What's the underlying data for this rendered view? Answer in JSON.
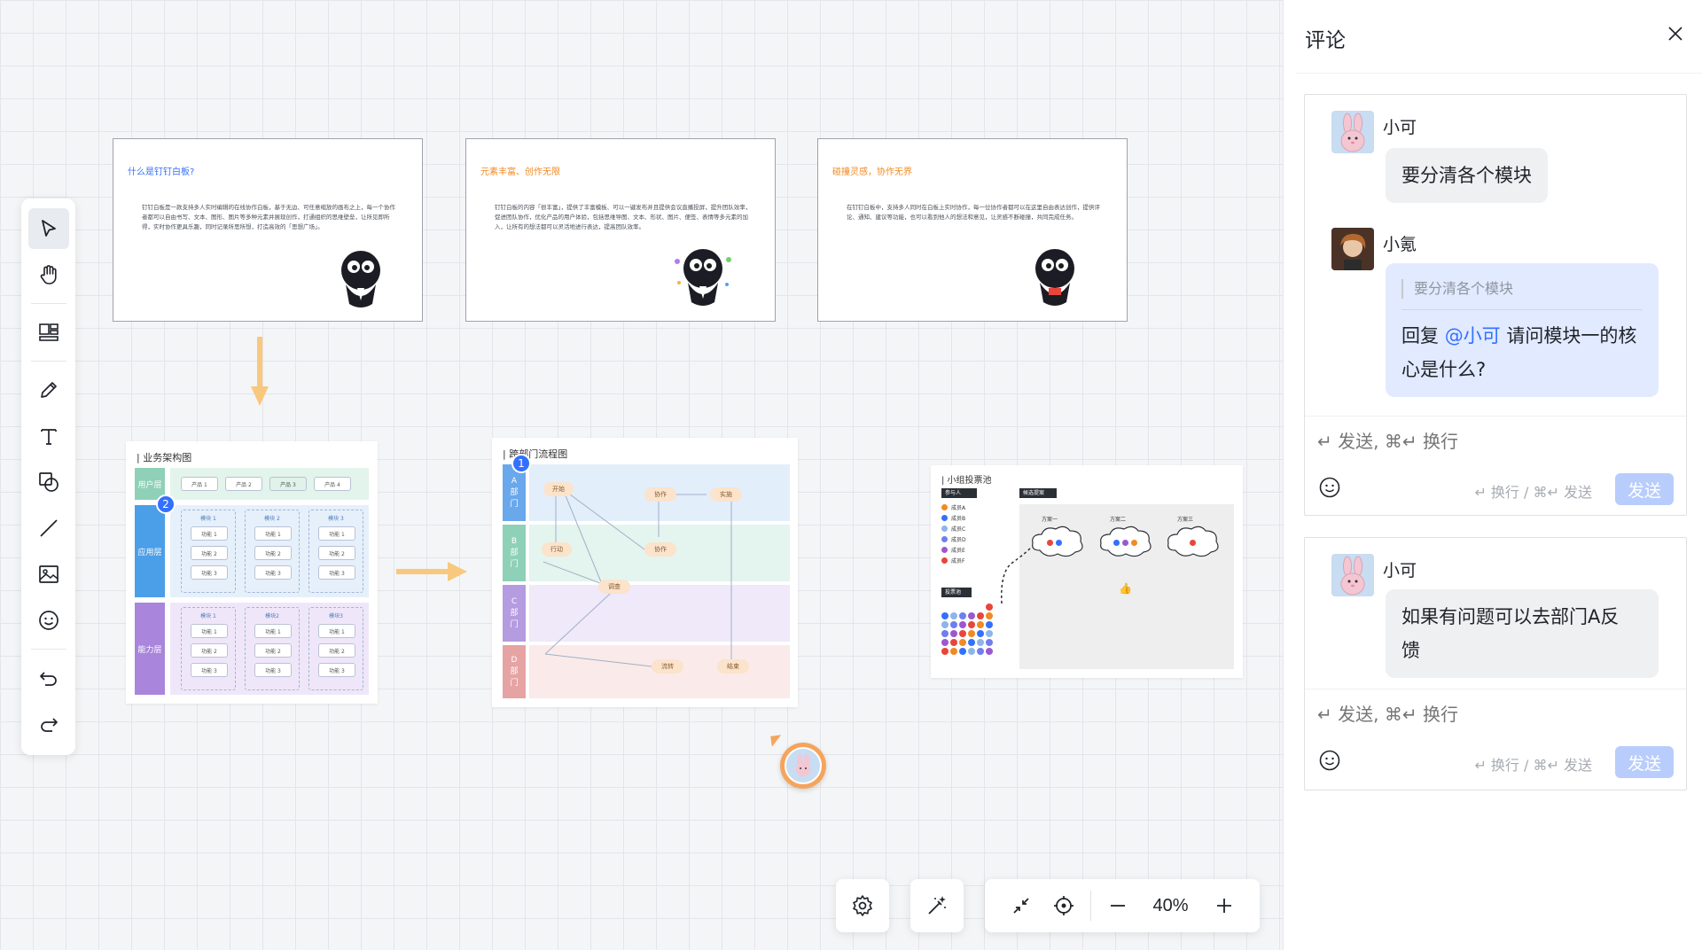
{
  "panel": {
    "title": "评论",
    "threads": [
      {
        "messages": [
          {
            "author": "小可",
            "text": "要分清各个模块"
          },
          {
            "author": "小氪",
            "quote": "要分清各个模块",
            "reply_prefix": "回复 ",
            "mention": "@小可",
            "reply_text_1": " 请问模块一的核",
            "reply_text_2": "心是什么?"
          }
        ],
        "input_placeholder": "↵ 发送, ⌘↵ 换行",
        "hint": "↵ 换行 / ⌘↵ 发送",
        "send_label": "发送"
      },
      {
        "messages": [
          {
            "author": "小可",
            "text_1": "如果有问题可以去部门A反",
            "text_2": "馈"
          }
        ],
        "input_placeholder": "↵ 发送, ⌘↵ 换行",
        "hint": "↵ 换行 / ⌘↵ 发送",
        "send_label": "发送"
      }
    ]
  },
  "slides": [
    {
      "title": "什么是钉钉白板?",
      "title_color": "#3370ff",
      "text": "钉钉白板是一款支持多人实时编辑的在线协作白板，基于无边、可任意缩放的画布之上，每一个协作者都可以自由书写、文本、图形、图片等多种元素并展现创作，打通组织的思维壁垒，让所见即所得，实时协作更具乐趣，同时记录所思所想，打造高效的「思想广场」。"
    },
    {
      "title": "元素丰富、创作无限",
      "title_color": "#f08a24",
      "text": "钉钉白板的内容「很丰富」，提供了丰富模板、可以一键发布并且提供会议直播投屏，提升团队效率，促进团队协作，优化产品的用户体验，包括思维导图、文本、形状、图片、便签、表情等多元素的加入，让所有的想法都可以灵活地进行表达，提高团队效率。"
    },
    {
      "title": "碰撞灵感，协作无界",
      "title_color": "#f08a24",
      "text": "在钉钉白板中，支持多人同时在白板上实时协作，每一位协作者都可以在这里自由表达创作，提供评论、通知、建议等功能，也可以看到他人的想法和意见，让灵感不断碰撞，共同完成任务。"
    }
  ],
  "boards": {
    "arch": {
      "title": "| 业务架构图",
      "lanes": [
        "用户层",
        "应用层",
        "能力层"
      ],
      "users": [
        "产品 1",
        "产品 2",
        "产品 3",
        "产品 4"
      ],
      "app_modules": [
        "模块 1",
        "模块 2",
        "模块 3"
      ],
      "app_items": [
        [
          "功能 1",
          "功能 1",
          "功能 1"
        ],
        [
          "功能 2",
          "功能 2",
          "功能 2"
        ],
        [
          "功能 3",
          "功能 3",
          "功能 3"
        ]
      ],
      "cap_modules": [
        "模块 1",
        "模块2",
        "模块3"
      ],
      "cap_items": [
        [
          "功能 1",
          "功能 1",
          "功能 1"
        ],
        [
          "功能 2",
          "功能 2",
          "功能 2"
        ],
        [
          "功能 3",
          "功能 3",
          "功能 3"
        ]
      ],
      "badge": "2"
    },
    "flow": {
      "title": "| 跨部门流程图",
      "lanes": [
        "A\n部\n门",
        "B\n部\n门",
        "C\n部\n门",
        "D\n部\n门"
      ],
      "nodes": [
        "开始",
        "协作",
        "实施",
        "行动",
        "协作",
        "调查",
        "流转",
        "结束"
      ],
      "badge": "1"
    },
    "vote": {
      "title": "| 小组投票池",
      "participants_label": "参与人",
      "participants": [
        "成员A",
        "成员B",
        "成员C",
        "成员D",
        "成员E",
        "成员F"
      ],
      "votes_label": "投票池",
      "options_label": "候选提案",
      "options": [
        "方案一",
        "方案二",
        "方案三"
      ]
    }
  },
  "zoom": {
    "value": "40%"
  },
  "colors": {
    "accent": "#3370ff",
    "send_disabled": "#b8cdfb",
    "arrow": "#f8c87e"
  }
}
